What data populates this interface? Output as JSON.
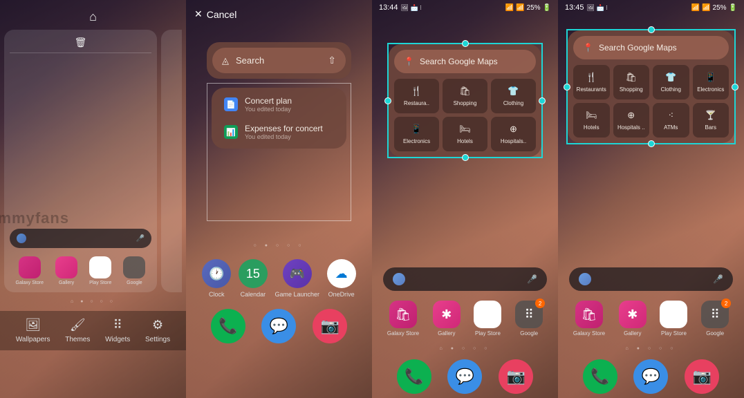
{
  "screen1": {
    "trash_icon": "🗑",
    "home_icon": "⌂",
    "apps": [
      {
        "label": "Galaxy Store",
        "icon": "galaxy"
      },
      {
        "label": "Gallery",
        "icon": "gallery"
      },
      {
        "label": "Play Store",
        "icon": "play"
      },
      {
        "label": "Google",
        "icon": "google"
      }
    ],
    "bottom_options": [
      {
        "label": "Wallpapers",
        "icon": "🖼"
      },
      {
        "label": "Themes",
        "icon": "🖌"
      },
      {
        "label": "Widgets",
        "icon": "⠿"
      },
      {
        "label": "Settings",
        "icon": "⚙"
      }
    ]
  },
  "screen2": {
    "cancel_label": "Cancel",
    "search_label": "Search",
    "items": [
      {
        "title": "Concert plan",
        "subtitle": "You edited today",
        "color": "#4285f4",
        "glyph": "📄"
      },
      {
        "title": "Expenses for concert",
        "subtitle": "You edited today",
        "color": "#0f9d58",
        "glyph": "📊"
      }
    ],
    "dock": [
      {
        "label": "Clock",
        "icon": "clock",
        "glyph": "🕐"
      },
      {
        "label": "Calendar",
        "icon": "calendar",
        "glyph": "15"
      },
      {
        "label": "Game Launcher",
        "icon": "gamelauncher",
        "glyph": "🎮"
      },
      {
        "label": "OneDrive",
        "icon": "onedrive",
        "glyph": "☁"
      }
    ],
    "dock2": [
      {
        "icon": "phone",
        "glyph": "📞"
      },
      {
        "icon": "message",
        "glyph": "💬"
      },
      {
        "icon": "camera",
        "glyph": "📷"
      }
    ]
  },
  "screen3": {
    "time": "13:44",
    "battery": "25%",
    "maps_search": "Search Google Maps",
    "tiles": [
      {
        "label": "Restaura..",
        "glyph": "🍴"
      },
      {
        "label": "Shopping",
        "glyph": "🛍"
      },
      {
        "label": "Clothing",
        "glyph": "👕"
      },
      {
        "label": "Electronics",
        "glyph": "📱"
      },
      {
        "label": "Hotels",
        "glyph": "🛏"
      },
      {
        "label": "Hospitals..",
        "glyph": "⊕"
      }
    ],
    "apps": [
      {
        "label": "Galaxy Store",
        "icon": "galaxy",
        "glyph": "🛍"
      },
      {
        "label": "Gallery",
        "icon": "gallery",
        "glyph": "✱"
      },
      {
        "label": "Play Store",
        "icon": "play",
        "glyph": "▶"
      },
      {
        "label": "Google",
        "icon": "google",
        "glyph": "⠿",
        "badge": "2"
      }
    ],
    "dock2": [
      {
        "icon": "phone",
        "glyph": "📞"
      },
      {
        "icon": "message",
        "glyph": "💬"
      },
      {
        "icon": "camera",
        "glyph": "📷"
      }
    ]
  },
  "screen4": {
    "time": "13:45",
    "battery": "25%",
    "maps_search": "Search Google Maps",
    "tiles": [
      {
        "label": "Restaurants",
        "glyph": "🍴"
      },
      {
        "label": "Shopping",
        "glyph": "🛍"
      },
      {
        "label": "Clothing",
        "glyph": "👕"
      },
      {
        "label": "Electronics",
        "glyph": "📱"
      },
      {
        "label": "Hotels",
        "glyph": "🛏"
      },
      {
        "label": "Hospitals ..",
        "glyph": "⊕"
      },
      {
        "label": "ATMs",
        "glyph": "⁖"
      },
      {
        "label": "Bars",
        "glyph": "🍸"
      }
    ],
    "apps": [
      {
        "label": "Galaxy Store",
        "icon": "galaxy",
        "glyph": "🛍"
      },
      {
        "label": "Gallery",
        "icon": "gallery",
        "glyph": "✱"
      },
      {
        "label": "Play Store",
        "icon": "play",
        "glyph": "▶"
      },
      {
        "label": "Google",
        "icon": "google",
        "glyph": "⠿",
        "badge": "2"
      }
    ],
    "dock2": [
      {
        "icon": "phone",
        "glyph": "📞"
      },
      {
        "icon": "message",
        "glyph": "💬"
      },
      {
        "icon": "camera",
        "glyph": "📷"
      }
    ]
  },
  "watermark": "sammyfans"
}
